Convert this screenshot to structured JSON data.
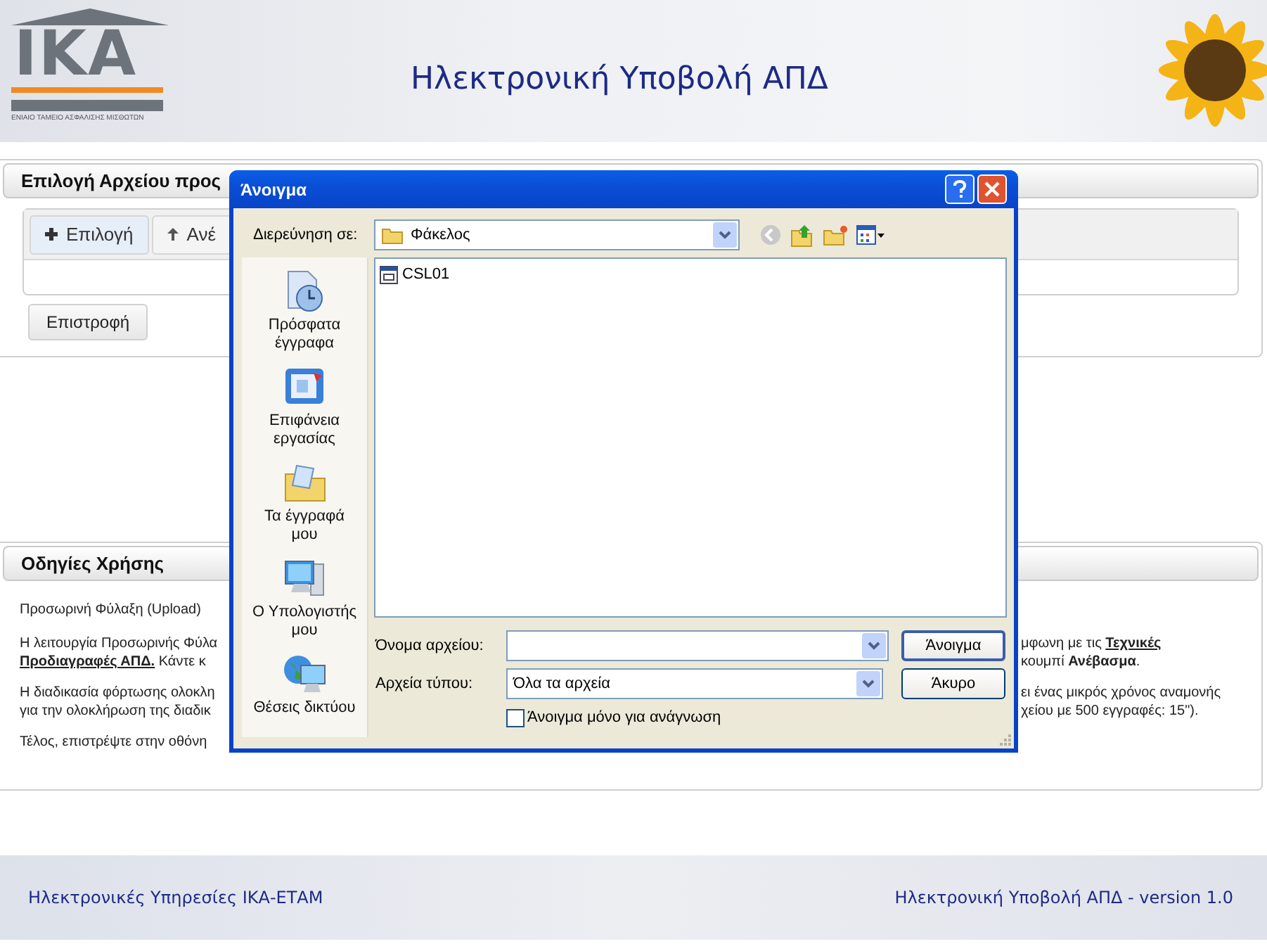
{
  "header": {
    "logo_text": "IKA",
    "logo_caption": "ΕΝΙΑΙΟ ΤΑΜΕΙΟ ΑΣΦΑΛΙΣΗΣ ΜΙΣΘΩΤΩΝ",
    "title": "Ηλεκτρονική Υποβολή ΑΠΔ"
  },
  "file_panel": {
    "title": "Επιλογή Αρχείου προς",
    "toolbar": [
      {
        "label": "Επιλογή",
        "kind": "add"
      },
      {
        "label": "Ανέ",
        "kind": "upload"
      }
    ],
    "back_button": "Επιστροφή"
  },
  "instructions": {
    "title": "Οδηγίες Χρήσης",
    "heading": "Προσωρινή Φύλαξη (Upload)",
    "paragraphs": [
      {
        "lines": [
          {
            "left": [
              {
                "kind": "text",
                "text": "Η λειτουργία Προσωρινής Φύλα"
              }
            ],
            "right": [
              {
                "kind": "text",
                "text": "μφωνη με τις "
              },
              {
                "kind": "link",
                "text": "Τεχνικές"
              }
            ]
          },
          {
            "left": [
              {
                "kind": "link",
                "text": "Προδιαγραφές ΑΠΔ."
              },
              {
                "kind": "text",
                "text": " Κάντε κ"
              }
            ],
            "right": [
              {
                "kind": "text",
                "text": "κουμπί **Ανέβασμα**."
              }
            ]
          }
        ]
      },
      {
        "lines": [
          {
            "left": [
              {
                "kind": "text",
                "text": "Η διαδικασία φόρτωσης ολοκλη"
              }
            ],
            "right": [
              {
                "kind": "text",
                "text": "ει ένας μικρός χρόνος αναμονής"
              }
            ]
          },
          {
            "left": [
              {
                "kind": "text",
                "text": "για την ολοκλήρωση της διαδικ"
              }
            ],
            "right": [
              {
                "kind": "text",
                "text": "χείου με 500 εγγραφές: 15\")."
              }
            ]
          }
        ]
      },
      {
        "lines": [
          {
            "left": [
              {
                "kind": "text",
                "text": "Τέλος, επιστρέψτε στην οθόνη"
              }
            ]
          }
        ]
      }
    ]
  },
  "footer": {
    "left": "Ηλεκτρονικές Υπηρεσίες ΙΚΑ-ΕΤΑΜ",
    "right": "Ηλεκτρονική Υποβολή ΑΠΔ - version 1.0"
  },
  "dialog": {
    "title": "Άνοιγμα",
    "look_in_label": "Διερεύνηση σε:",
    "look_in_value": "Φάκελος",
    "places": [
      {
        "label": "Πρόσφατα έγγραφα",
        "kind": "recent"
      },
      {
        "label": "Επιφάνεια εργασίας",
        "kind": "desktop"
      },
      {
        "label": "Τα έγγραφά μου",
        "kind": "documents"
      },
      {
        "label": "Ο Υπολογιστής μου",
        "kind": "computer"
      },
      {
        "label": "Θέσεις δικτύου",
        "kind": "network"
      }
    ],
    "files": [
      {
        "name": "CSL01"
      }
    ],
    "filename_label": "Όνομα αρχείου:",
    "filetype_label": "Αρχεία τύπου:",
    "filetype_value": "Όλα τα αρχεία",
    "readonly_checkbox": {
      "label": "Άνοιγμα μόνο για ανάγνωση",
      "checked": false
    },
    "buttons": [
      {
        "label": "Άνοιγμα",
        "kind": "default"
      },
      {
        "label": "Άκυρο",
        "kind": "normal"
      }
    ]
  }
}
